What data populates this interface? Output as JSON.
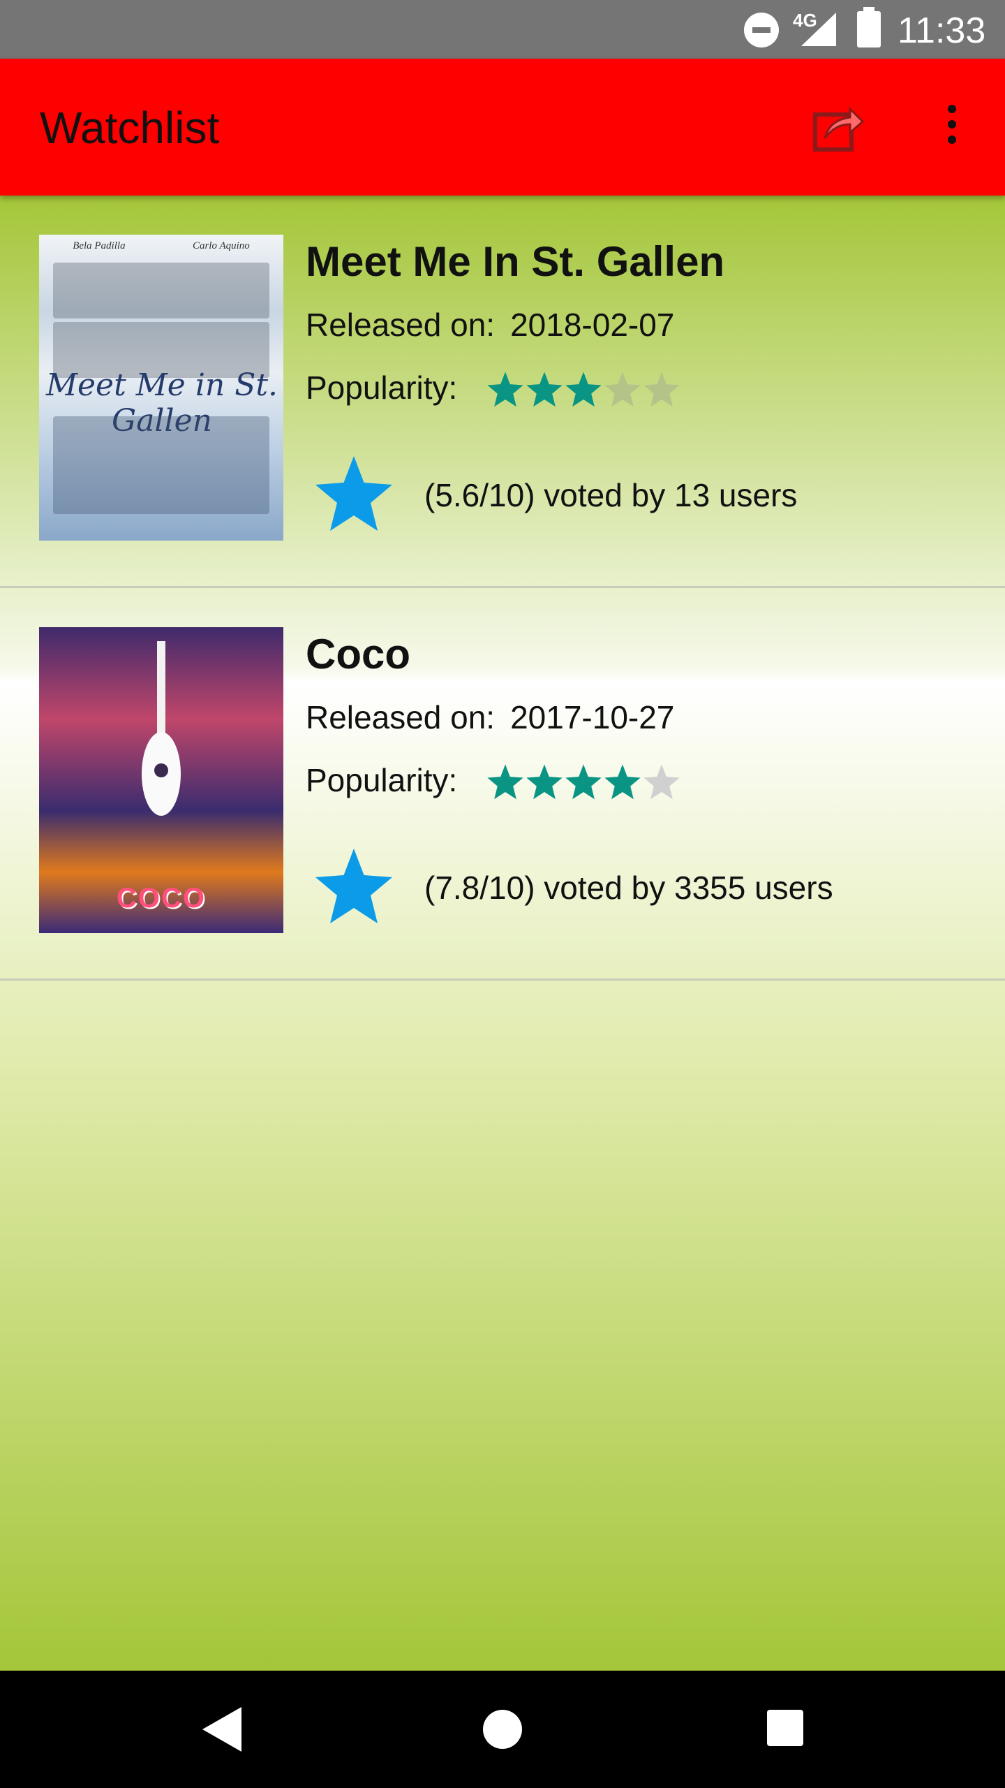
{
  "status_bar": {
    "network": "4G",
    "time": "11:33"
  },
  "app_bar": {
    "title": "Watchlist",
    "share_icon": "share-icon",
    "more_icon": "more-vert-icon"
  },
  "movies": [
    {
      "title": "Meet Me In St. Gallen",
      "release_label": "Released on:",
      "release_date": "2018-02-07",
      "popularity_label": "Popularity:",
      "popularity_stars": 3,
      "popularity_max": 5,
      "votes_text": "(5.6/10) voted by 13 users",
      "poster": {
        "credit_left": "Bela Padilla",
        "credit_right": "Carlo Aquino",
        "title_art": "Meet Me in St. Gallen"
      }
    },
    {
      "title": "Coco",
      "release_label": "Released on:",
      "release_date": "2017-10-27",
      "popularity_label": "Popularity:",
      "popularity_stars": 4,
      "popularity_max": 5,
      "votes_text": "(7.8/10) voted by 3355 users",
      "poster": {
        "title_art": "COCO"
      }
    }
  ],
  "colors": {
    "app_bar": "#ff0000",
    "star_filled": "#0a9484",
    "star_empty_1": "#b4c488",
    "star_empty_2": "#d0d0d0",
    "vote_star": "#0b9be8",
    "background_green": "#a4c639"
  },
  "nav_bar": {
    "back_icon": "back-icon",
    "home_icon": "home-icon",
    "recents_icon": "recents-icon"
  }
}
